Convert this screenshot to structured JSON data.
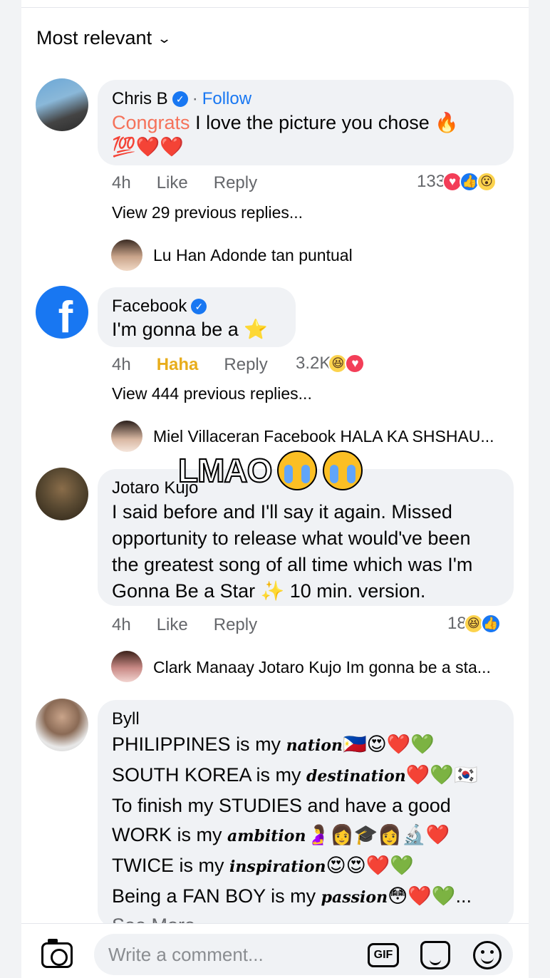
{
  "sort_label": "Most relevant",
  "comments": [
    {
      "name": "Chris B",
      "follow": "Follow",
      "text_highlight": "Congrats",
      "text": " I love the picture you chose 🔥",
      "text_line2": "💯❤️❤️",
      "time": "4h",
      "like": "Like",
      "reply": "Reply",
      "reaction_count": "133",
      "view_previous": "View 29 previous replies...",
      "reply_preview": {
        "name": "Lu Han",
        "text": "Adonde tan puntual"
      }
    },
    {
      "name": "Facebook",
      "text": "I'm gonna be a ⭐",
      "time": "4h",
      "like": "Haha",
      "reply": "Reply",
      "reaction_count": "3.2K",
      "view_previous": "View 444 previous replies...",
      "reply_preview": {
        "name": "Miel Villaceran",
        "text": "Facebook HALA KA SHSHAU..."
      }
    },
    {
      "name": "Jotaro Kujo",
      "text": "I said before and I'll say it again. Missed opportunity to release what would've been the greatest song of all time which was I'm Gonna Be a Star ✨ 10 min. version.",
      "time": "4h",
      "like": "Like",
      "reply": "Reply",
      "reaction_count": "18",
      "reply_preview": {
        "name": "Clark Manaay",
        "text": "Jotaro Kujo Im gonna be a sta..."
      }
    },
    {
      "name": "Byll",
      "lines": [
        {
          "a": "PHILIPPINES is my ",
          "f": "nation",
          "e": "🇵🇭😍❤️💚"
        },
        {
          "a": "SOUTH KOREA is my ",
          "f": "destination",
          "e": "❤️💚🇰🇷"
        },
        {
          "a": "To finish my STUDIES and have a good",
          "f": "",
          "e": ""
        },
        {
          "a": "WORK is my ",
          "f": "ambition",
          "e": "🤰👩🎓👩🔬❤️"
        },
        {
          "a": "TWICE is my ",
          "f": "inspiration",
          "e": "😍😍❤️💚"
        },
        {
          "a": "Being a FAN BOY is my ",
          "f": "passion",
          "e": "😳❤️💚..."
        }
      ],
      "see_more": "See More"
    }
  ],
  "overlay": "LMAO",
  "composer": {
    "placeholder": "Write a comment...",
    "gif": "GIF"
  },
  "icons": {
    "verified": "verified-badge-icon",
    "sort": "chevron-down-icon",
    "camera": "camera-icon",
    "gif": "gif-icon",
    "sticker": "sticker-icon",
    "emoji": "emoji-icon"
  }
}
